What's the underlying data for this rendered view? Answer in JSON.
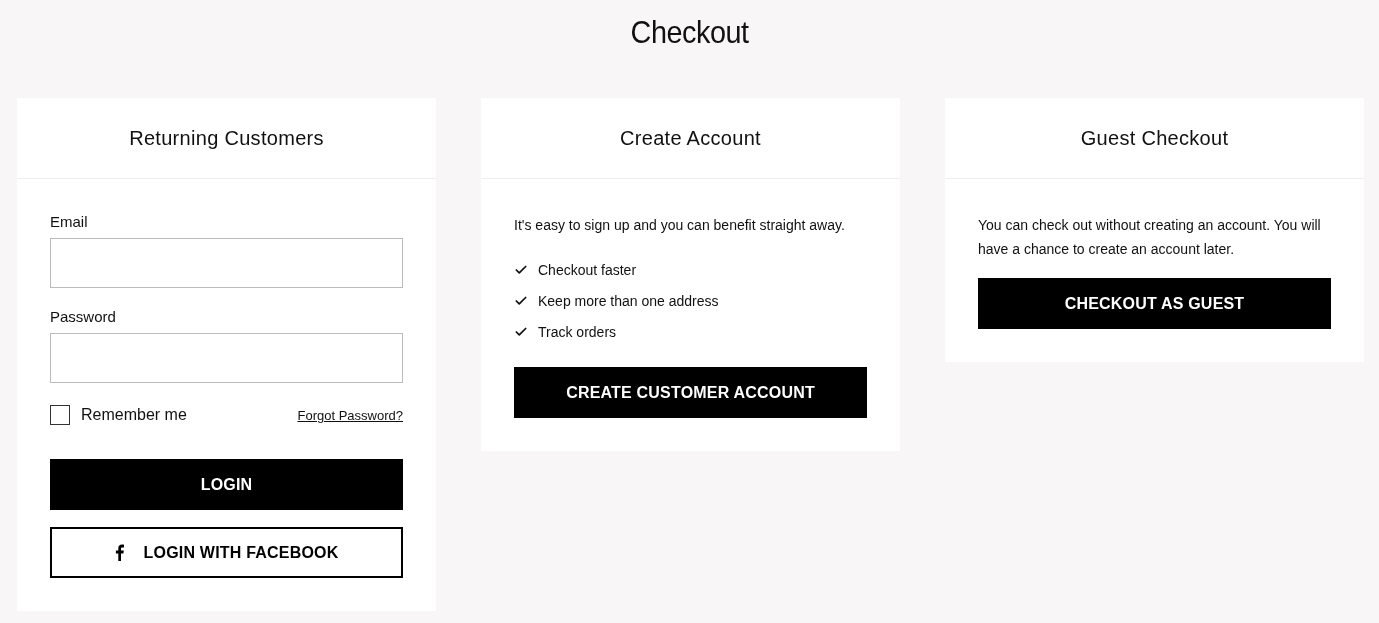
{
  "title": "Checkout",
  "returning": {
    "title": "Returning Customers",
    "fields": [
      {
        "label": "Email"
      },
      {
        "label": "Password"
      }
    ],
    "remember": {
      "label": "Remember me",
      "checked": false
    },
    "forgot_link": "Forgot Password?",
    "buttons": [
      {
        "label": "LOGIN",
        "kind": "primary"
      },
      {
        "label": "LOGIN WITH FACEBOOK",
        "kind": "facebook"
      }
    ]
  },
  "create": {
    "title": "Create Account",
    "intro": "It's easy to sign up and you can benefit straight away.",
    "benefits": [
      "Checkout faster",
      "Keep more than one address",
      "Track orders"
    ],
    "button": "CREATE CUSTOMER ACCOUNT"
  },
  "guest": {
    "title": "Guest Checkout",
    "text": "You can check out without creating an account. You will have a chance to create an account later.",
    "button": "CHECKOUT AS GUEST"
  }
}
